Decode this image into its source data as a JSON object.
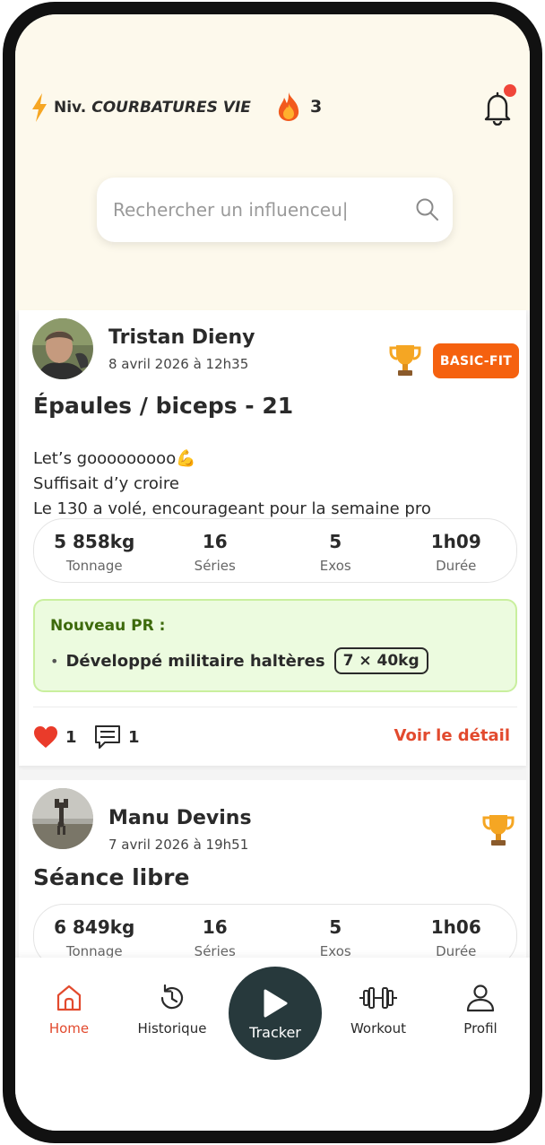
{
  "header": {
    "level_label": "Niv.",
    "level_value": "COURBATURES VIE",
    "streak_count": "3",
    "search_placeholder": "Rechercher un influenceu|",
    "colors": {
      "background": "#fdf9ec",
      "notification_dot": "#f0463a",
      "bolt": "#f6a623"
    }
  },
  "posts": [
    {
      "author": "Tristan Dieny",
      "date": "8 avril 2026 à 12h35",
      "gym_badge": "BASIC-FIT",
      "title": "Épaules / biceps - 21",
      "description": [
        "Let’s gooooooooo💪",
        "Suffisait d’y croire",
        "Le 130 a volé, encourageant pour la semaine pro"
      ],
      "stats": [
        {
          "value": "5 858kg",
          "label": "Tonnage"
        },
        {
          "value": "16",
          "label": "Séries"
        },
        {
          "value": "5",
          "label": "Exos"
        },
        {
          "value": "1h09",
          "label": "Durée"
        }
      ],
      "pr": {
        "title": "Nouveau PR :",
        "bullet": "•",
        "exercise": "Développé militaire haltères",
        "value": "7 × 40kg"
      },
      "likes": "1",
      "comments": "1",
      "detail_link": "Voir le détail"
    },
    {
      "author": "Manu Devins",
      "date": "7 avril 2026 à 19h51",
      "title": "Séance libre",
      "stats": [
        {
          "value": "6 849kg",
          "label": "Tonnage"
        },
        {
          "value": "16",
          "label": "Séries"
        },
        {
          "value": "5",
          "label": "Exos"
        },
        {
          "value": "1h06",
          "label": "Durée"
        }
      ]
    }
  ],
  "nav": {
    "home": "Home",
    "history": "Historique",
    "tracker": "Tracker",
    "workout": "Workout",
    "profile": "Profil",
    "colors": {
      "active": "#e24a2e",
      "tracker_bg": "#27393c"
    }
  },
  "colors": {
    "accent": "#e24a2e",
    "badge": "#f5610f",
    "pr_bg": "#ecfbdf",
    "pr_border": "#c9ef9e",
    "pr_title": "#3d6a0b"
  }
}
